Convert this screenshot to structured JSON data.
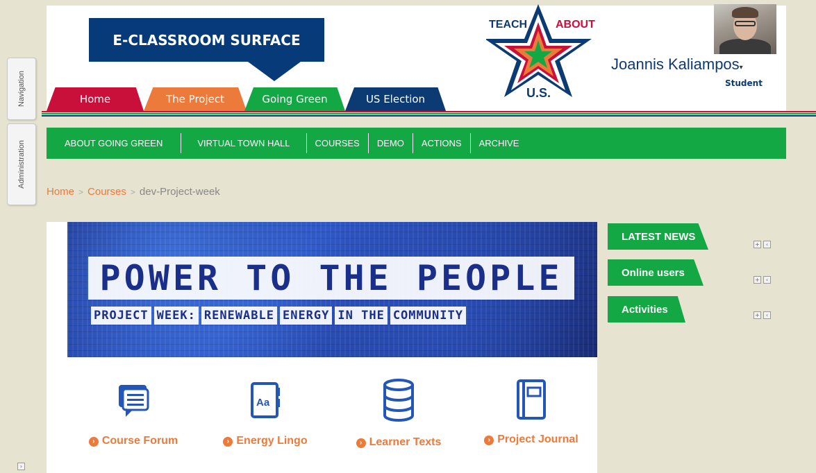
{
  "side_tabs": {
    "navigation": "Navigation",
    "administration": "Administration"
  },
  "brand": {
    "title": "E-CLASSROOM SURFACE"
  },
  "logo": {
    "top_left": "TEACH",
    "top_right": "ABOUT",
    "bottom": "U.S."
  },
  "tabs": [
    {
      "label": "Home",
      "color": "#c8103b"
    },
    {
      "label": "The Project",
      "color": "#ec7a3a"
    },
    {
      "label": "Going Green",
      "color": "#13a844"
    },
    {
      "label": "US Election",
      "color": "#0c3b73"
    }
  ],
  "user": {
    "name": "Joannis Kaliampos",
    "caret": "▾",
    "role": "Student"
  },
  "navbar": {
    "items": [
      "ABOUT GOING GREEN",
      "VIRTUAL TOWN HALL",
      "COURSES",
      "DEMO",
      "ACTIONS",
      "ARCHIVE"
    ]
  },
  "breadcrumb": {
    "home": "Home",
    "courses": "Courses",
    "current": "dev-Project-week",
    "separator": ">"
  },
  "banner": {
    "title": "POWER TO THE PEOPLE",
    "subtitle_parts": [
      "PROJECT",
      "WEEK:",
      "RENEWABLE",
      "ENERGY",
      "IN THE",
      "COMMUNITY"
    ]
  },
  "resources": [
    {
      "label": "Course Forum",
      "icon": "forum-icon"
    },
    {
      "label": "Energy Lingo",
      "icon": "glossary-icon"
    },
    {
      "label": "Learner Texts",
      "icon": "database-icon"
    },
    {
      "label": "Project Journal",
      "icon": "journal-icon"
    }
  ],
  "blocks": [
    {
      "label": "LATEST NEWS"
    },
    {
      "label": "Online users"
    },
    {
      "label": "Activities"
    }
  ],
  "colors": {
    "green": "#13a844",
    "orange": "#ec7a3a",
    "navy": "#0c3b73",
    "red": "#c8103b",
    "background": "#e6e3d0"
  }
}
